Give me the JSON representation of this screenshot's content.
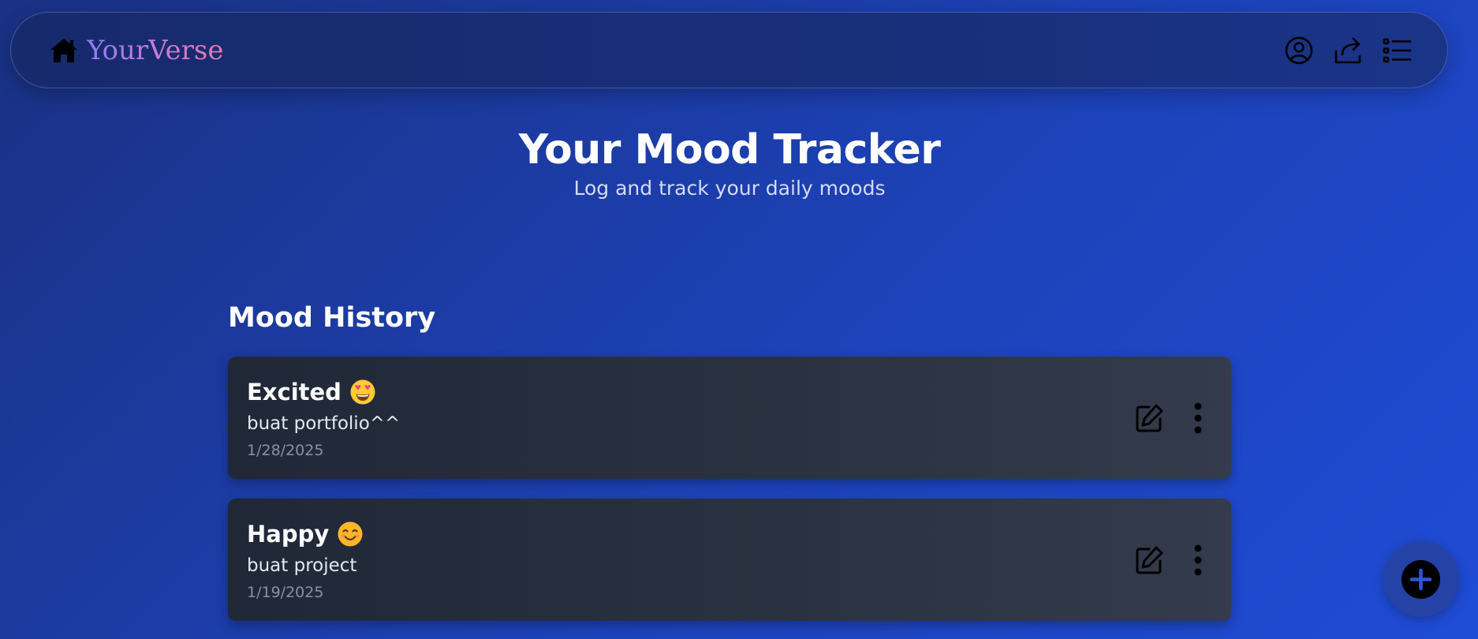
{
  "navbar": {
    "brand_name": "YourVerse",
    "icons": [
      "home-icon",
      "user-circle-icon",
      "share-icon",
      "list-icon"
    ]
  },
  "header": {
    "title": "Your Mood Tracker",
    "subtitle": "Log and track your daily moods"
  },
  "history": {
    "title": "Mood History",
    "entries": [
      {
        "mood": "Excited",
        "emoji": "star-struck-face",
        "note": "buat portfolio^^",
        "date": "1/28/2025"
      },
      {
        "mood": "Happy",
        "emoji": "smiling-face",
        "note": "buat project",
        "date": "1/19/2025"
      }
    ]
  },
  "colors": {
    "background_start": "#1a3183",
    "background_end": "#1f4cd6",
    "card": "#2a3241",
    "brand_gradient_start": "#8b7cf6",
    "brand_gradient_end": "#e879a8",
    "fab_accent": "#2542a6"
  }
}
